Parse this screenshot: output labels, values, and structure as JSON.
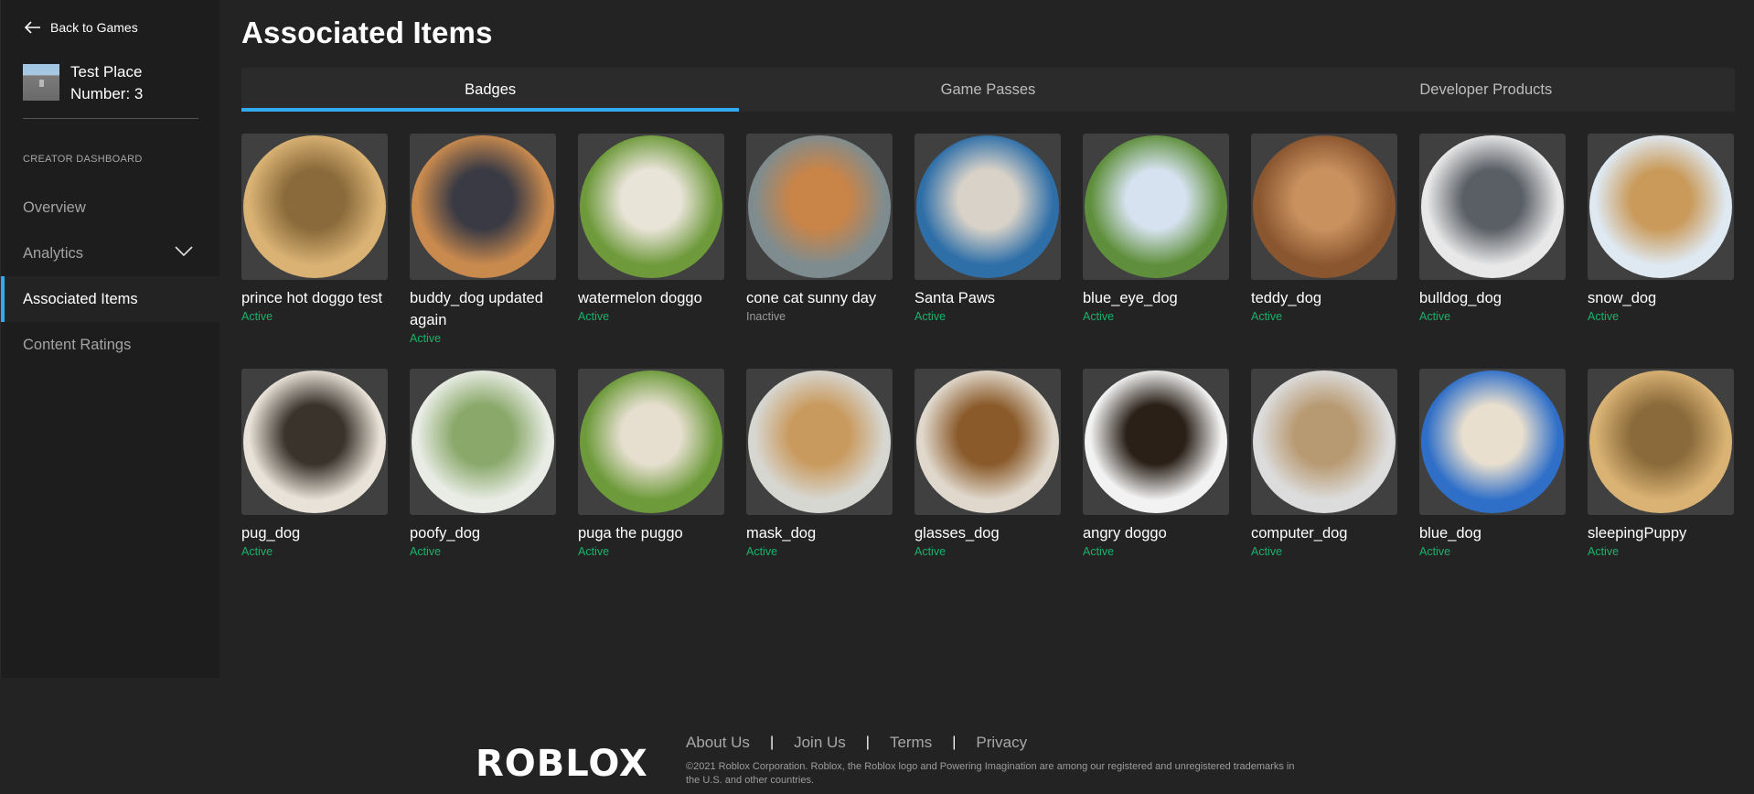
{
  "sidebar": {
    "back_label": "Back to Games",
    "place_name": "Test Place Number: 3",
    "section_heading": "CREATOR DASHBOARD",
    "nav": [
      {
        "label": "Overview",
        "active": false
      },
      {
        "label": "Analytics",
        "active": false,
        "expandable": true
      },
      {
        "label": "Associated Items",
        "active": true
      },
      {
        "label": "Content Ratings",
        "active": false
      }
    ]
  },
  "main": {
    "title": "Associated Items",
    "tabs": [
      {
        "label": "Badges",
        "active": true
      },
      {
        "label": "Game Passes",
        "active": false
      },
      {
        "label": "Developer Products",
        "active": false
      }
    ],
    "items": [
      {
        "name": "prince hot doggo test",
        "status": "Active"
      },
      {
        "name": "buddy_dog updated again",
        "status": "Active"
      },
      {
        "name": "watermelon doggo",
        "status": "Active"
      },
      {
        "name": "cone cat sunny day",
        "status": "Inactive"
      },
      {
        "name": "Santa Paws",
        "status": "Active"
      },
      {
        "name": "blue_eye_dog",
        "status": "Active"
      },
      {
        "name": "teddy_dog",
        "status": "Active"
      },
      {
        "name": "bulldog_dog",
        "status": "Active"
      },
      {
        "name": "snow_dog",
        "status": "Active"
      },
      {
        "name": "pug_dog",
        "status": "Active"
      },
      {
        "name": "poofy_dog",
        "status": "Active"
      },
      {
        "name": "puga the puggo",
        "status": "Active"
      },
      {
        "name": "mask_dog",
        "status": "Active"
      },
      {
        "name": "glasses_dog",
        "status": "Active"
      },
      {
        "name": "angry doggo",
        "status": "Active"
      },
      {
        "name": "computer_dog",
        "status": "Active"
      },
      {
        "name": "blue_dog",
        "status": "Active"
      },
      {
        "name": "sleepingPuppy",
        "status": "Active"
      }
    ]
  },
  "footer": {
    "logo_text": "ROBLOX",
    "links": [
      "About Us",
      "Join Us",
      "Terms",
      "Privacy"
    ],
    "copyright": "©2021 Roblox Corporation. Roblox, the Roblox logo and Powering Imagination are among our registered and unregistered trademarks in the U.S. and other countries."
  },
  "colors": {
    "accent": "#33a9f0",
    "active_status": "#19b26b",
    "inactive_status": "#9a9a9a",
    "background": "#232323",
    "sidebar": "#1d1d1d"
  }
}
